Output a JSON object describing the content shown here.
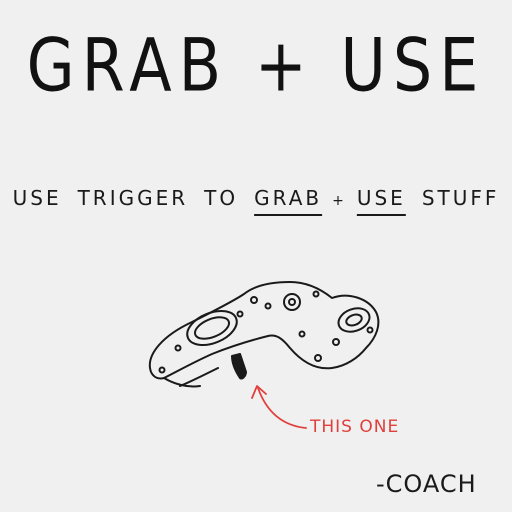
{
  "title": "GRAB + USE",
  "instruction": {
    "part1": "USE",
    "part2": "TRIGGER",
    "part3": "TO",
    "grab": "GRAB",
    "plus": "+",
    "use": "USE",
    "part4": "STUFF"
  },
  "illustration": {
    "icon": "vr-controller-icon"
  },
  "callout": {
    "text": "THIS ONE",
    "color": "#e0403c"
  },
  "signature": "-COACH",
  "colors": {
    "background": "#f0f0f0",
    "ink": "#1a1a1a",
    "accent": "#e0403c"
  }
}
